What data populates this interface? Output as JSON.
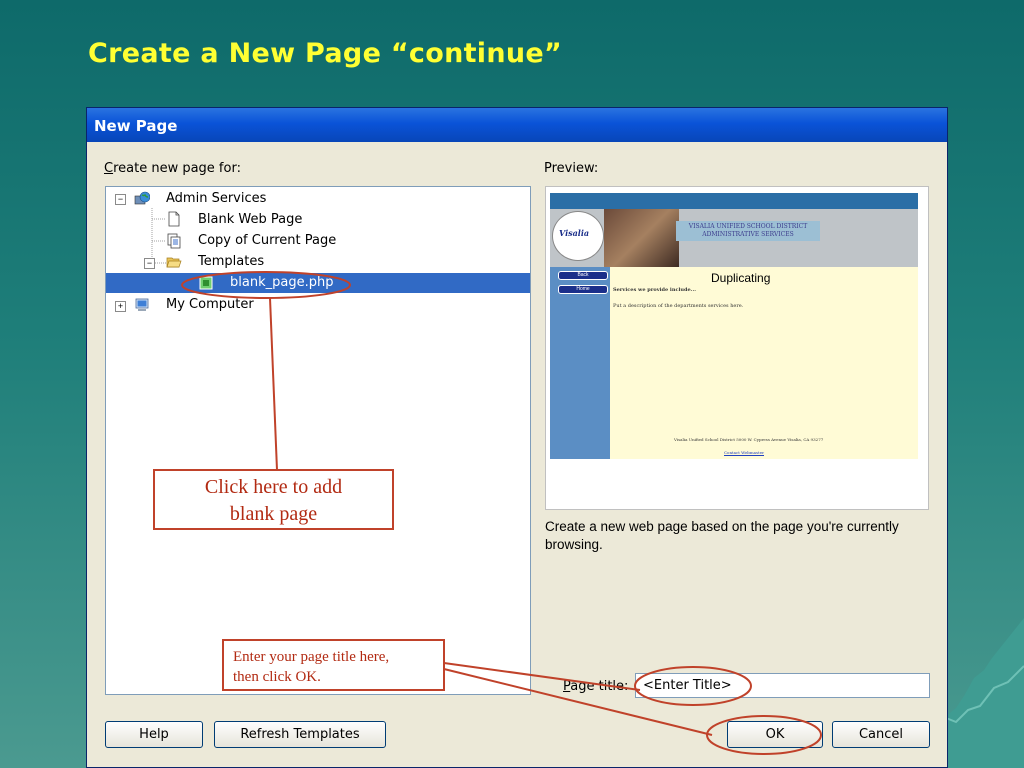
{
  "slide": {
    "title": "Create a New Page “continue”"
  },
  "dialog": {
    "title": "New Page",
    "create_label_first": "C",
    "create_label_rest": "reate new page for:",
    "preview_label": "Preview:",
    "tree": [
      {
        "label": "Admin Services",
        "expander": "−",
        "icon": "globe-computer-icon"
      },
      {
        "label": "Blank Web Page",
        "icon": "blank-page-icon"
      },
      {
        "label": "Copy of Current Page",
        "icon": "copy-page-icon"
      },
      {
        "label": "Templates",
        "expander": "−",
        "icon": "open-folder-icon"
      },
      {
        "label": "blank_page.php",
        "icon": "php-file-icon",
        "selected": true
      },
      {
        "label": "My Computer",
        "expander": "+",
        "icon": "my-computer-icon"
      }
    ],
    "preview": {
      "heading": "Duplicating",
      "school_line1": "VISALIA UNIFIED SCHOOL DISTRICT",
      "school_line2": "ADMINISTRATIVE SERVICES",
      "logo_text": "Visalia",
      "btn_back": "Back",
      "btn_home": "Home",
      "services": "Services we provide include...",
      "put_desc": "Put a description of the departments services here.",
      "footer": "Visalia Unified School District 5000 W. Cypress Avenue Visalia, CA 93277",
      "contact": "Contact Webmaster"
    },
    "description": "Create a new web page based on the page you're currently browsing.",
    "page_title_label_first": "P",
    "page_title_label_rest": "age title:",
    "page_title_value": "<Enter Title>",
    "buttons": {
      "help": "Help",
      "refresh": "Refresh Templates",
      "ok": "OK",
      "cancel": "Cancel"
    }
  },
  "annotations": {
    "callout1_line1": "Click here to add",
    "callout1_line2": "blank page",
    "callout2_line1": "Enter your page title here,",
    "callout2_line2": "then click OK."
  },
  "colors": {
    "title_yellow": "#ffff33",
    "annotation_red": "#c0422a",
    "selection_blue": "#316ac5"
  }
}
